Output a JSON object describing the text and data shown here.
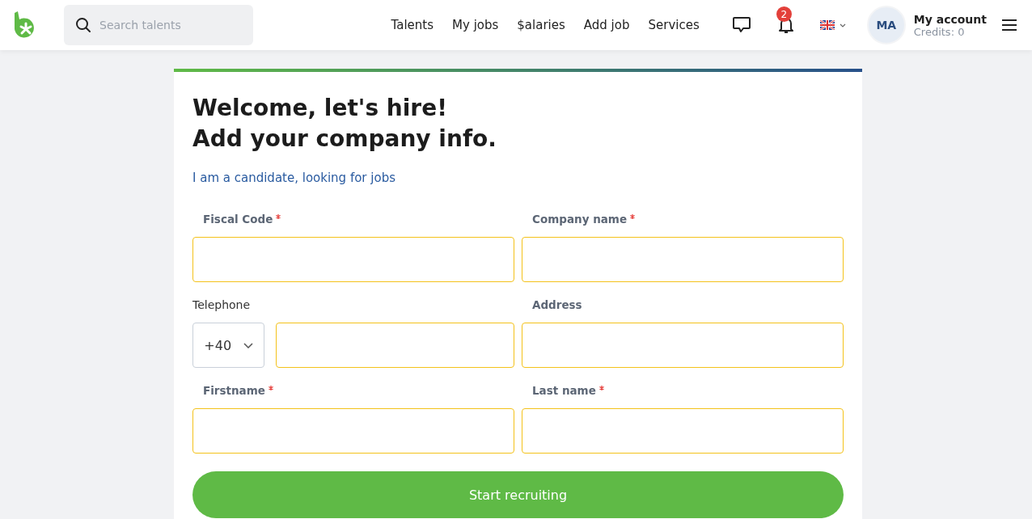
{
  "header": {
    "search": {
      "placeholder": "Search talents"
    },
    "nav": [
      "Talents",
      "My jobs",
      "$alaries",
      "Add job",
      "Services"
    ],
    "notifications": {
      "count": "2"
    },
    "account": {
      "initials": "MA",
      "name": "My account",
      "credits": "Credits: 0"
    }
  },
  "form": {
    "title_lines": [
      "Welcome, let's hire!",
      "Add your company info."
    ],
    "candidate_link": "I am a candidate, looking for jobs",
    "fields": [
      {
        "kind": "text",
        "label": "Fiscal Code",
        "required": true
      },
      {
        "kind": "text",
        "label": "Company name",
        "required": true
      },
      {
        "kind": "phone",
        "label": "Telephone",
        "required": false,
        "code": "+40"
      },
      {
        "kind": "text",
        "label": "Address",
        "required": false
      },
      {
        "kind": "text",
        "label": "Firstname",
        "required": true
      },
      {
        "kind": "text",
        "label": "Last name",
        "required": true
      }
    ],
    "submit": "Start recruiting"
  }
}
